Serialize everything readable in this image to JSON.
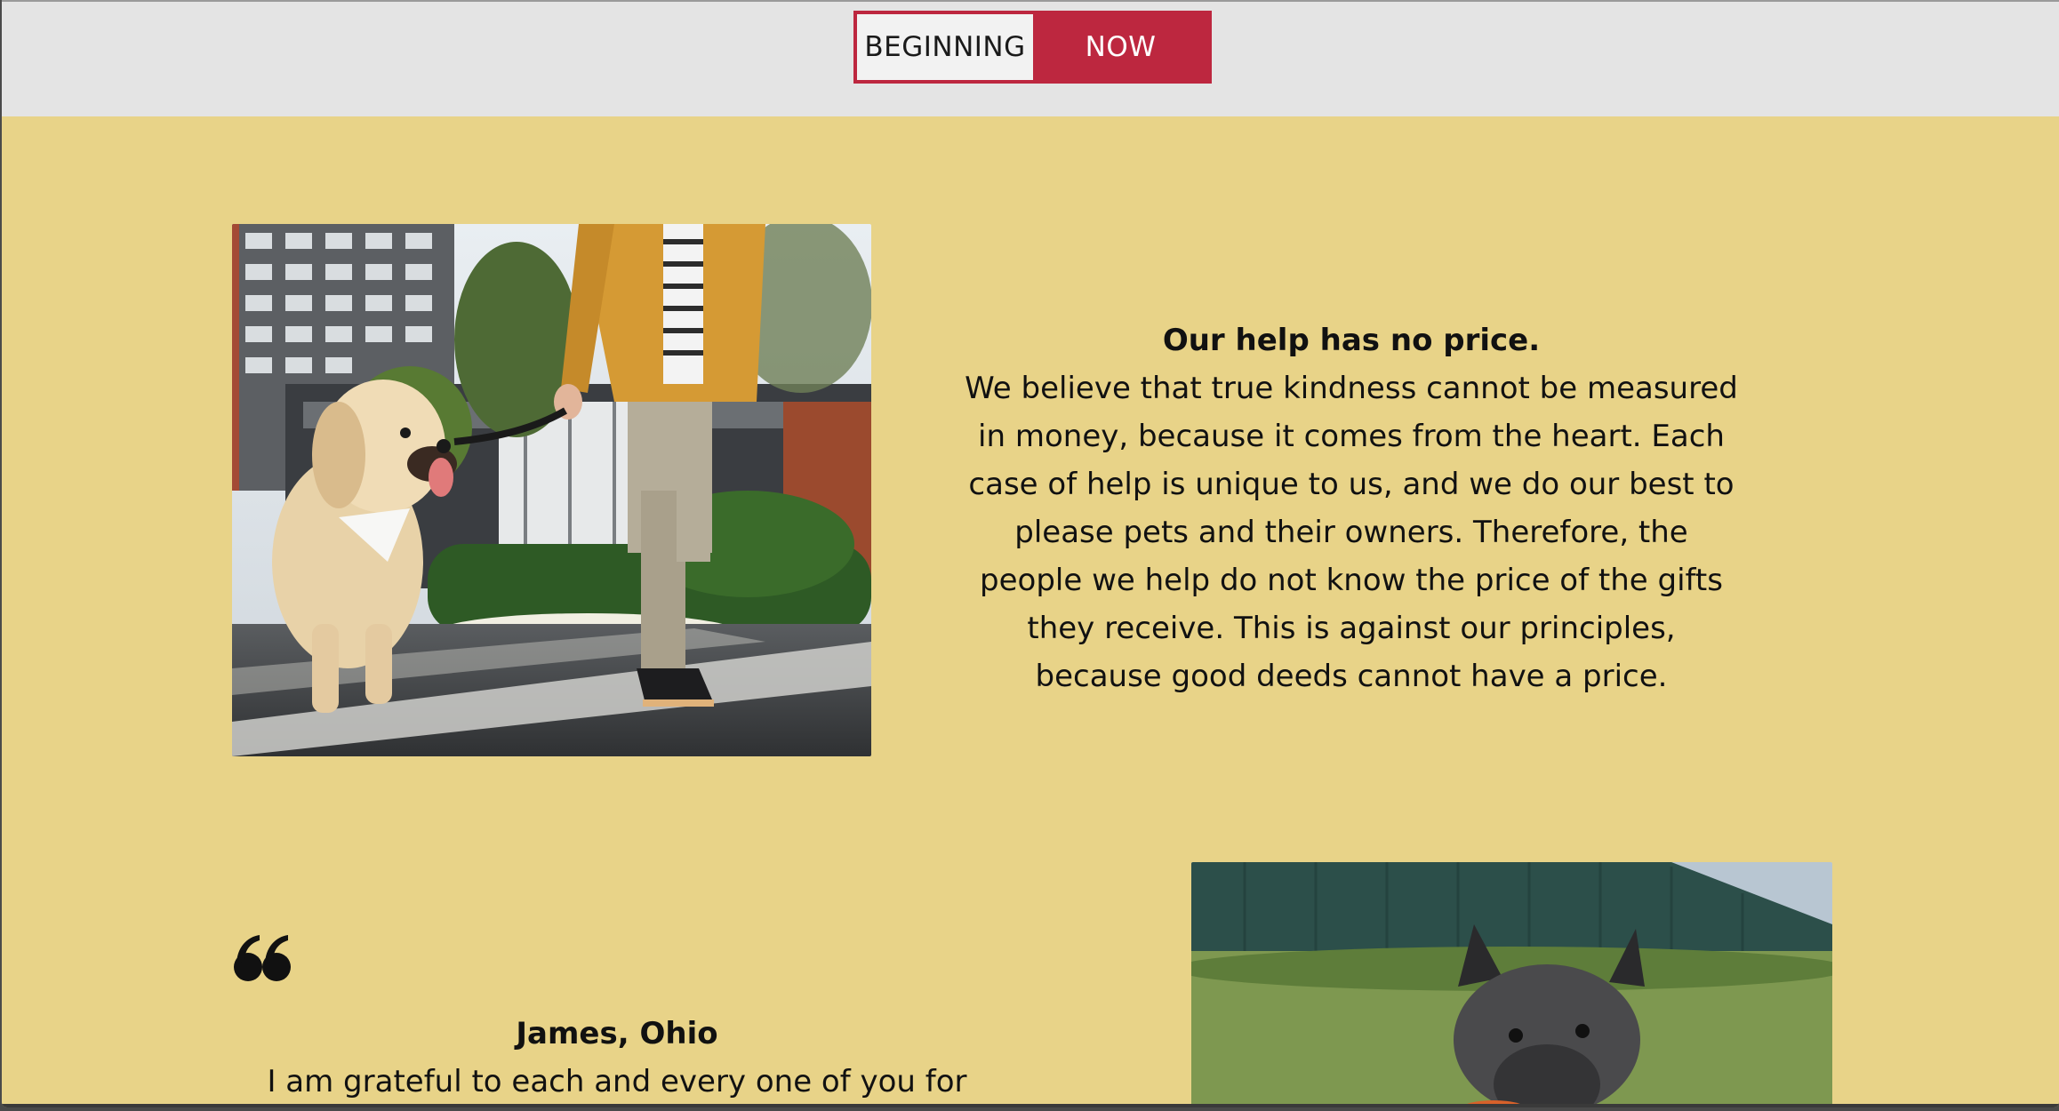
{
  "toggle": {
    "beginning_label": "BEGINNING",
    "now_label": "NOW",
    "active": "NOW",
    "accent_color": "#bd273f"
  },
  "section_help": {
    "title": "Our help has no price.",
    "body": "We believe that true kindness cannot be measured in money, because it comes from the heart. Each case of help is unique to us, and we do our best to please pets and their owners. Therefore, the people we help do not know the price of the gifts they receive. This is against our principles, because good deeds cannot have a price."
  },
  "testimonial": {
    "author": "James, Ohio",
    "text": "I am grateful to each and every one of you for"
  },
  "colors": {
    "page_background": "#e8d388",
    "header_background": "#e4e4e4",
    "text": "#111111"
  }
}
